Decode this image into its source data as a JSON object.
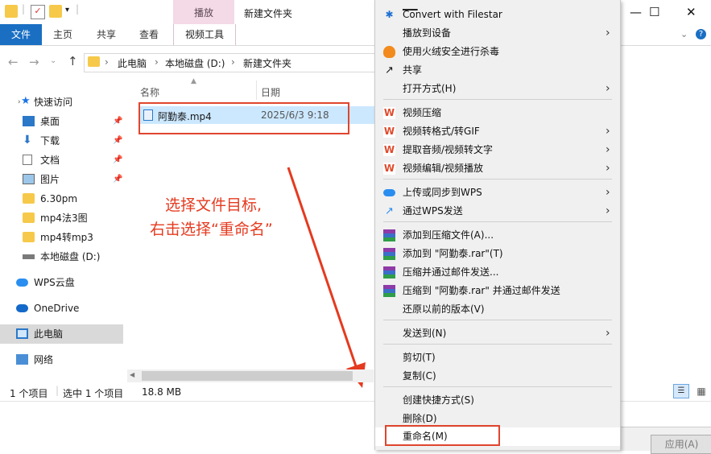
{
  "window": {
    "title": "新建文件夹",
    "contextual_tab": "播放",
    "controls": {
      "minimize": "—",
      "maximize": "☐",
      "close": "✕"
    }
  },
  "ribbon": {
    "tabs": [
      "文件",
      "主页",
      "共享",
      "查看",
      "视频工具"
    ]
  },
  "address": {
    "segments": [
      "此电脑",
      "本地磁盘 (D:)",
      "新建文件夹"
    ]
  },
  "sidebar": {
    "items": [
      {
        "label": "快速访问",
        "icon": "star-icon",
        "pinned": false
      },
      {
        "label": "桌面",
        "icon": "desktop-icon",
        "pinned": true
      },
      {
        "label": "下载",
        "icon": "download-icon",
        "pinned": true
      },
      {
        "label": "文档",
        "icon": "document-icon",
        "pinned": true
      },
      {
        "label": "图片",
        "icon": "picture-icon",
        "pinned": true
      },
      {
        "label": "6.30pm",
        "icon": "folder-icon",
        "pinned": false
      },
      {
        "label": "mp4法3图",
        "icon": "folder-icon",
        "pinned": false
      },
      {
        "label": "mp4转mp3",
        "icon": "folder-icon",
        "pinned": false
      },
      {
        "label": "本地磁盘 (D:)",
        "icon": "drive-icon",
        "pinned": false
      },
      {
        "label": "WPS云盘",
        "icon": "cloud-icon",
        "pinned": false
      },
      {
        "label": "OneDrive",
        "icon": "onedrive-icon",
        "pinned": false
      },
      {
        "label": "此电脑",
        "icon": "pc-icon",
        "pinned": false
      },
      {
        "label": "网络",
        "icon": "network-icon",
        "pinned": false
      }
    ]
  },
  "filelist": {
    "columns": {
      "name": "名称",
      "date": "日期"
    },
    "rows": [
      {
        "name": "阿勤泰.mp4",
        "date": "2025/6/3 9:18"
      }
    ]
  },
  "annotation": {
    "line1": "选择文件目标,",
    "line2": "右击选择“重命名”",
    "color": "#e53a1f"
  },
  "statusbar": {
    "count": "1 个项目",
    "selected": "选中 1 个项目",
    "size": "18.8 MB"
  },
  "dialog": {
    "apply": "应用(A)"
  },
  "context_menu": {
    "items": [
      {
        "label": "Convert with Filestar",
        "icon": "filestar-icon",
        "submenu": false
      },
      {
        "label": "播放到设备",
        "icon": "none",
        "submenu": true
      },
      {
        "label": "使用火绒安全进行杀毒",
        "icon": "huorong-icon",
        "submenu": false
      },
      {
        "label": "共享",
        "icon": "share-icon",
        "submenu": false
      },
      {
        "label": "打开方式(H)",
        "icon": "none",
        "submenu": true
      },
      {
        "label": "视频压缩",
        "icon": "wps-icon",
        "submenu": false
      },
      {
        "label": "视频转格式/转GIF",
        "icon": "wps-icon",
        "submenu": true
      },
      {
        "label": "提取音频/视频转文字",
        "icon": "wps-icon",
        "submenu": true
      },
      {
        "label": "视频编辑/视频播放",
        "icon": "wps-icon",
        "submenu": true
      },
      {
        "label": "上传或同步到WPS",
        "icon": "wps-cloud-icon",
        "submenu": true
      },
      {
        "label": "通过WPS发送",
        "icon": "wps-send-icon",
        "submenu": true
      },
      {
        "label": "添加到压缩文件(A)...",
        "icon": "winrar-icon",
        "submenu": false
      },
      {
        "label": "添加到 \"阿勤泰.rar\"(T)",
        "icon": "winrar-icon",
        "submenu": false
      },
      {
        "label": "压缩并通过邮件发送...",
        "icon": "winrar-icon",
        "submenu": false
      },
      {
        "label": "压缩到 \"阿勤泰.rar\" 并通过邮件发送",
        "icon": "winrar-icon",
        "submenu": false
      },
      {
        "label": "还原以前的版本(V)",
        "icon": "none",
        "submenu": false
      },
      {
        "label": "发送到(N)",
        "icon": "none",
        "submenu": true
      },
      {
        "label": "剪切(T)",
        "icon": "none",
        "submenu": false
      },
      {
        "label": "复制(C)",
        "icon": "none",
        "submenu": false
      },
      {
        "label": "创建快捷方式(S)",
        "icon": "none",
        "submenu": false
      },
      {
        "label": "删除(D)",
        "icon": "none",
        "submenu": false
      },
      {
        "label": "重命名(M)",
        "icon": "none",
        "submenu": false
      }
    ]
  }
}
